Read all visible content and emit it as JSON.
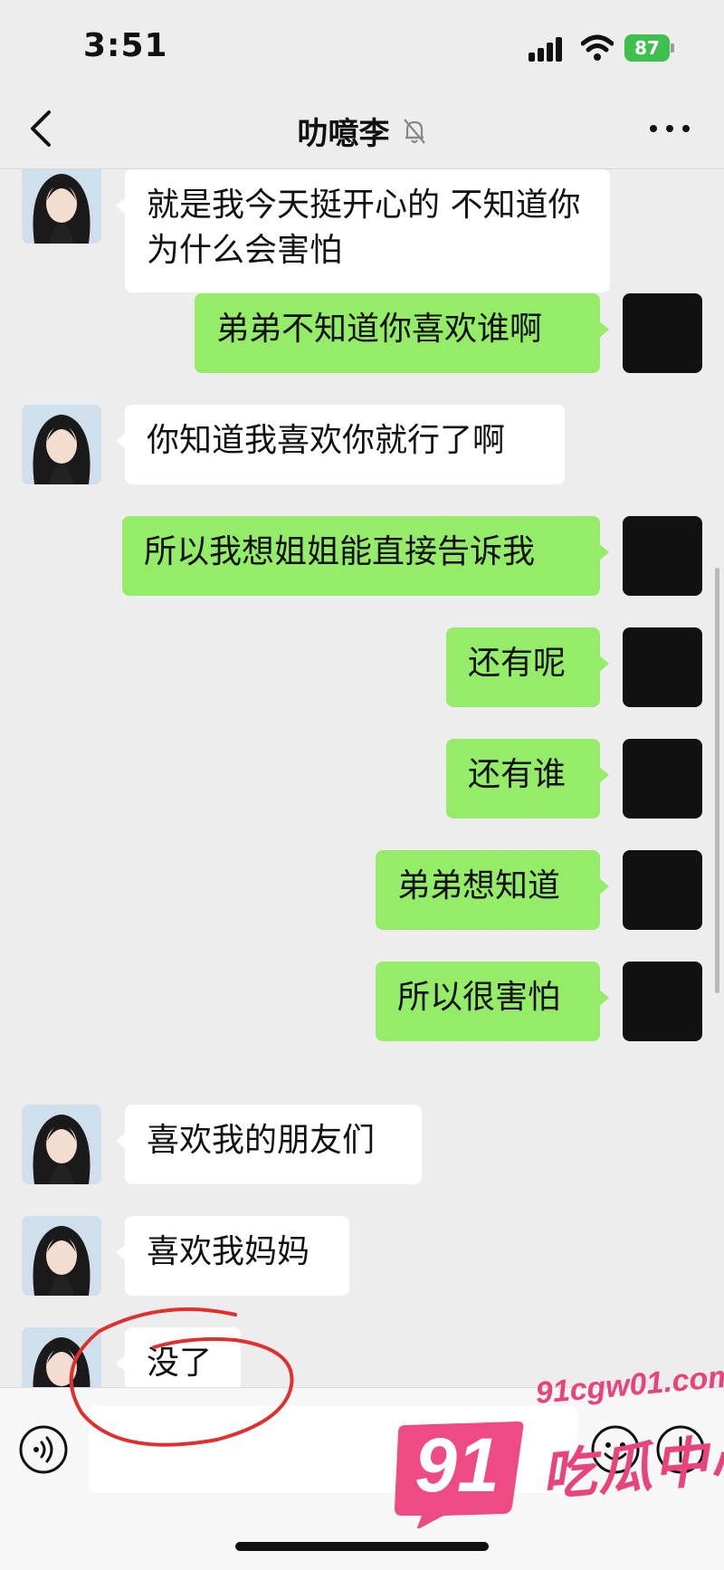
{
  "status_bar": {
    "time": "3:51",
    "battery": "87"
  },
  "nav": {
    "title": "叻噫李"
  },
  "messages": [
    {
      "from": "them",
      "text": "就是我今天挺开心的 不知道你为什么会害怕"
    },
    {
      "from": "me",
      "text": "弟弟不知道你喜欢谁啊"
    },
    {
      "from": "them",
      "text": "你知道我喜欢你就行了啊"
    },
    {
      "from": "me",
      "text": "所以我想姐姐能直接告诉我"
    },
    {
      "from": "me",
      "text": "还有呢"
    },
    {
      "from": "me",
      "text": "还有谁"
    },
    {
      "from": "me",
      "text": "弟弟想知道"
    },
    {
      "from": "me",
      "text": "所以很害怕"
    },
    {
      "from": "them",
      "text": "喜欢我的朋友们"
    },
    {
      "from": "them",
      "text": "喜欢我妈妈"
    },
    {
      "from": "them",
      "text": "没了"
    }
  ],
  "input": {
    "value": ""
  },
  "watermark": {
    "badge": "91",
    "url": "91cgw01.com",
    "text": "吃瓜中心"
  },
  "colors": {
    "background": "#ededed",
    "bubble_me": "#95ec69",
    "bubble_them": "#ffffff",
    "annotation": "#e0302e",
    "watermark": "#e9437d"
  },
  "icons": [
    "back-chevron-icon",
    "mute-bell-icon",
    "more-dots-icon",
    "voice-icon",
    "emoji-icon",
    "plus-icon"
  ]
}
